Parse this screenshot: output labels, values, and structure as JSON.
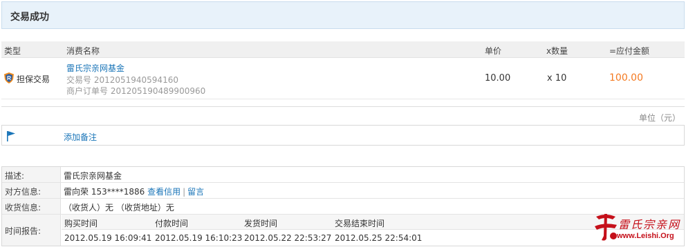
{
  "banner": {
    "title": "交易成功"
  },
  "table": {
    "headers": {
      "type": "类型",
      "name": "消费名称",
      "price": "单价",
      "qty": "x数量",
      "amount": "=应付金额"
    },
    "row": {
      "type": "担保交易",
      "name": "雷氏宗亲网基金",
      "trade_no": "交易号 2012051940594160",
      "order_no": "商户订单号 201205190489900960",
      "price": "10.00",
      "qty": "x 10",
      "amount": "100.00"
    }
  },
  "unit": "单位（元）",
  "remark": {
    "link": "添加备注"
  },
  "info": {
    "desc_label": "描述:",
    "desc_value": "雷氏宗亲网基金",
    "party_label": "对方信息:",
    "party_name": "雷向荣 153****1886",
    "party_credit_link": "查看信用",
    "party_message_link": "留言",
    "party_sep": "|",
    "receiver_label": "收货信息:",
    "receiver_value": "（收货人）无 （收货地址）无",
    "time_label": "时间报告:",
    "timeline": {
      "h1": "购买时间",
      "h2": "付款时间",
      "h3": "发货时间",
      "h4": "交易结束时间",
      "v1": "2012.05.19 16:09:41",
      "v2": "2012.05.19 16:10:23",
      "v3": "2012.05.22 22:53:27",
      "v4": "2012.05.25 22:54:01"
    }
  },
  "watermark": {
    "text": "雷氏宗亲网",
    "url": "www.Leishi.Org"
  },
  "colors": {
    "link": "#1a75b8",
    "amount": "#f47920",
    "banner_bg": "#e8f2fa",
    "watermark": "#c5101a"
  }
}
